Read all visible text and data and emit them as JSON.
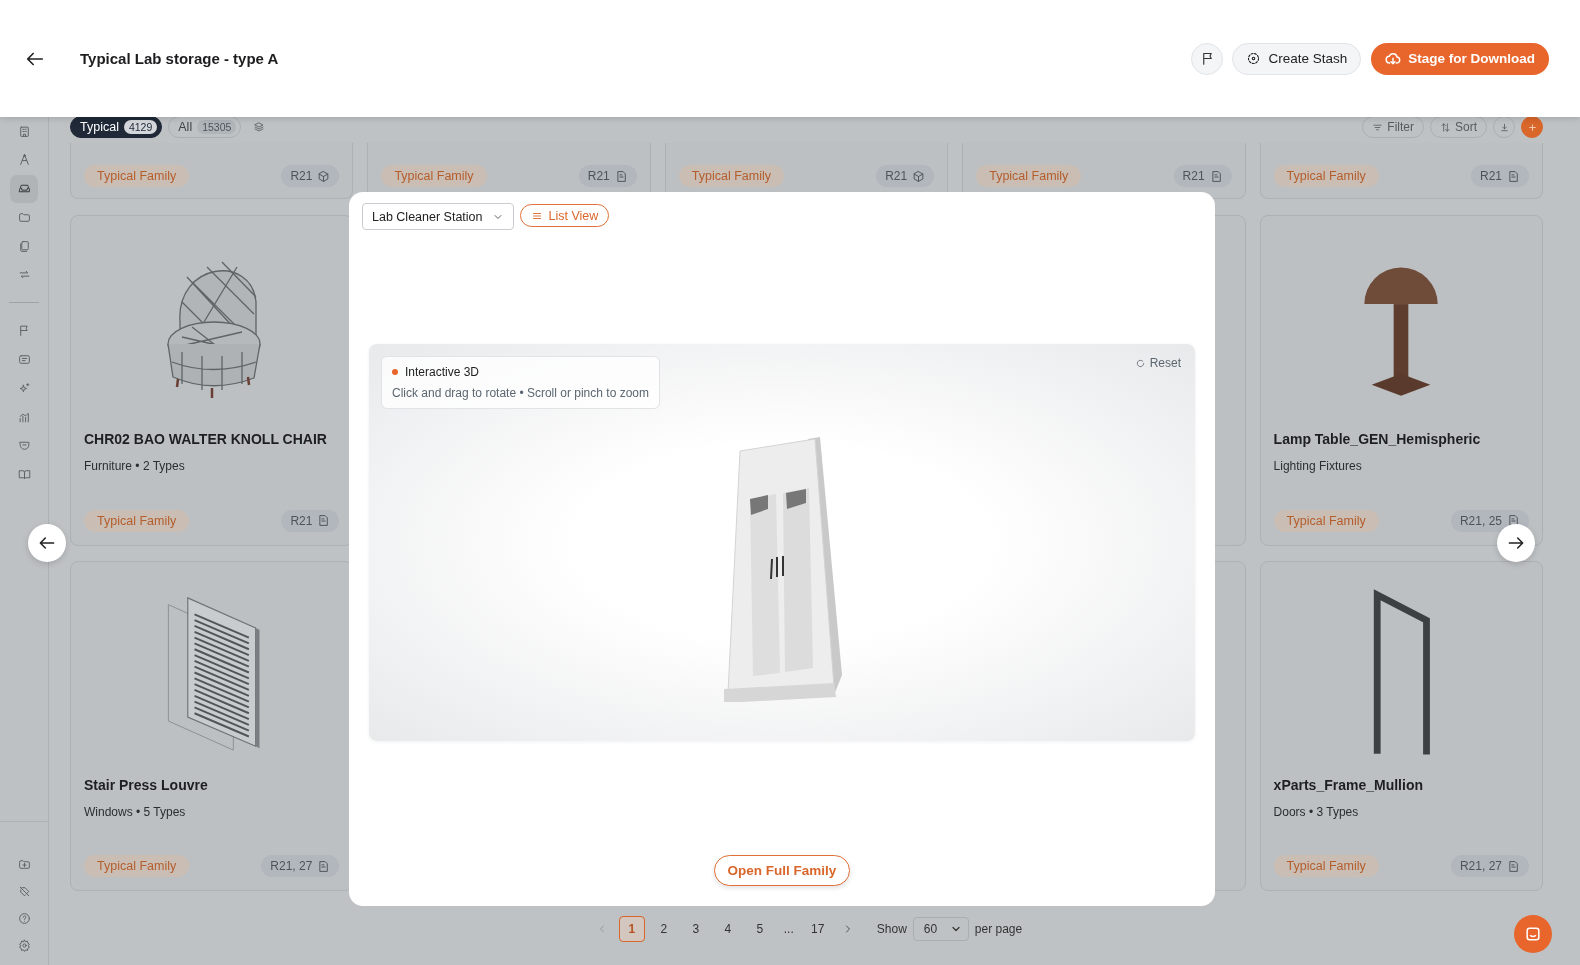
{
  "header": {
    "title": "Typical Lab storage - type A",
    "create_button": "Create Stash",
    "stage_button": "Stage for Download"
  },
  "sidebar": {
    "items": [
      {
        "selected": false
      },
      {
        "selected": false
      },
      {
        "selected": true
      },
      {
        "selected": false
      },
      {
        "selected": false
      },
      {
        "selected": false
      },
      {
        "selected": false
      },
      {
        "selected": false
      },
      {
        "selected": false
      },
      {
        "selected": false
      },
      {
        "selected": false
      },
      {
        "selected": false
      }
    ],
    "bottom_items": [
      {
        "selected": false
      },
      {
        "selected": false
      },
      {
        "selected": false
      },
      {
        "selected": false
      }
    ]
  },
  "toolbar": {
    "tabs": [
      {
        "label": "Typical",
        "count": "4129",
        "selected": true
      },
      {
        "label": "All",
        "count": "15305",
        "selected": false
      }
    ],
    "filter": "Filter",
    "sort": "Sort"
  },
  "grid": {
    "top_row": [
      {
        "tag": "Typical Family",
        "badge": "R21",
        "kind": "cube"
      },
      {
        "tag": "Typical Family",
        "badge": "R21",
        "kind": "file"
      },
      {
        "tag": "Typical Family",
        "badge": "R21",
        "kind": "cube"
      },
      {
        "tag": "Typical Family",
        "badge": "R21",
        "kind": "file"
      },
      {
        "tag": "Typical Family",
        "badge": "R21",
        "kind": "file"
      }
    ],
    "rows": [
      {
        "cards": [
          {
            "title": "CHR02 BAO WALTER KNOLL CHAIR",
            "subtitle": "Furniture • 2 Types",
            "tag": "Typical Family",
            "badge": "R21",
            "kind": "file"
          },
          {
            "title": "Lamp Table_GEN_Hemispheric",
            "subtitle": "Lighting Fixtures",
            "tag": "Typical Family",
            "badge": "R21, 25",
            "kind": "file"
          }
        ]
      },
      {
        "cards": [
          {
            "title": "Stair Press Louvre",
            "subtitle": "Windows • 5 Types",
            "tag": "Typical Family",
            "badge": "R21, 27",
            "kind": "file"
          },
          {
            "title": "xParts_Frame_Mullion",
            "subtitle": "Doors • 3 Types",
            "tag": "Typical Family",
            "badge": "R21, 27",
            "kind": "file"
          }
        ]
      }
    ]
  },
  "pagination": {
    "prev_disabled": true,
    "next_disabled": false,
    "pages": [
      {
        "label": "1",
        "kind": "page",
        "selected": true
      },
      {
        "label": "2",
        "kind": "page",
        "selected": false
      },
      {
        "label": "3",
        "kind": "page",
        "selected": false
      },
      {
        "label": "4",
        "kind": "page",
        "selected": false
      },
      {
        "label": "5",
        "kind": "page",
        "selected": false
      },
      {
        "label": "...",
        "kind": "gap"
      },
      {
        "label": "17",
        "kind": "page",
        "selected": false
      }
    ],
    "show_label": "Show",
    "per_page": "60",
    "per_page_label": "per page"
  },
  "modal": {
    "family_select": "Lab Cleaner Station",
    "list_view": "List View",
    "viewer": {
      "title": "Interactive 3D",
      "hint": "Click and drag to rotate • Scroll or pinch to zoom",
      "reset": "Reset"
    },
    "open_button": "Open Full Family"
  }
}
